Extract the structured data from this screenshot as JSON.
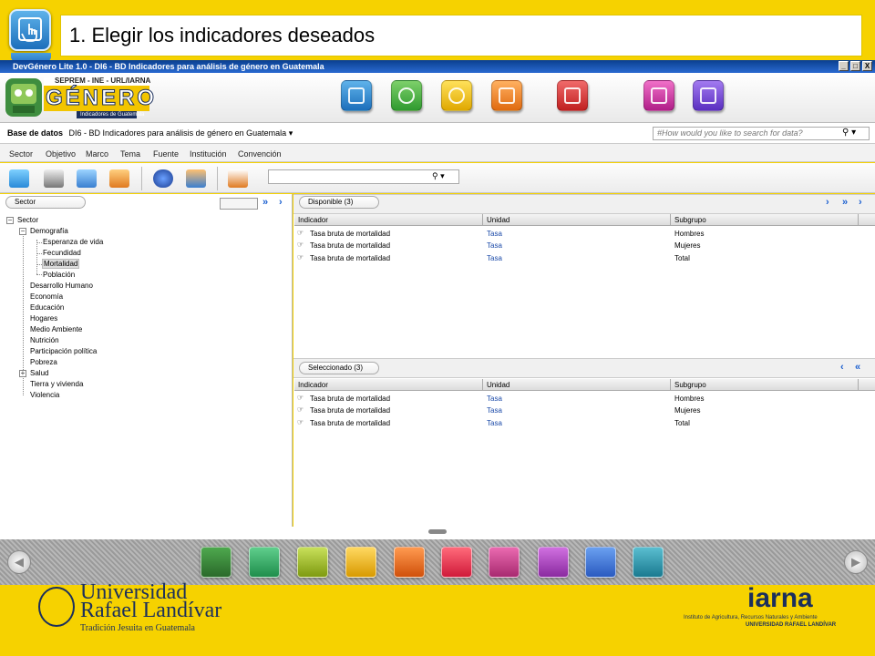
{
  "slide": {
    "title": "1. Elegir los indicadores deseados"
  },
  "window": {
    "title": "DevGénero Lite 1.0 - DI6 - BD Indicadores para análisis de género en Guatemala",
    "btn_min": "_",
    "btn_max": "□",
    "btn_close": "X"
  },
  "logo": {
    "org_line": "SEPREM - INE - URL/IARNA",
    "name": "GÉNERO",
    "tagline": "Indicadores de Guatemala"
  },
  "dbbar": {
    "label": "Base de datos",
    "value": "DI6 - BD Indicadores para análisis de género en Guatemala",
    "search_placeholder": "#How would you like to search for data?"
  },
  "menu": [
    "Sector",
    "Objetivo",
    "Marco",
    "Tema",
    "Fuente",
    "Institución",
    "Convención"
  ],
  "left": {
    "pill": "Sector",
    "tree": [
      {
        "label": "Sector",
        "level": 0,
        "expander": "−"
      },
      {
        "label": "Demografía",
        "level": 1,
        "expander": "−"
      },
      {
        "label": "Esperanza de vida",
        "level": 2
      },
      {
        "label": "Fecundidad",
        "level": 2
      },
      {
        "label": "Mortalidad",
        "level": 2,
        "selected": true
      },
      {
        "label": "Población",
        "level": 2
      },
      {
        "label": "Desarrollo Humano",
        "level": 1
      },
      {
        "label": "Economía",
        "level": 1
      },
      {
        "label": "Educación",
        "level": 1
      },
      {
        "label": "Hogares",
        "level": 1
      },
      {
        "label": "Medio Ambiente",
        "level": 1
      },
      {
        "label": "Nutrición",
        "level": 1
      },
      {
        "label": "Participación política",
        "level": 1
      },
      {
        "label": "Pobreza",
        "level": 1
      },
      {
        "label": "Salud",
        "level": 1,
        "expander": "+"
      },
      {
        "label": "Tierra y vivienda",
        "level": 1
      },
      {
        "label": "Violencia",
        "level": 1
      }
    ]
  },
  "available": {
    "pill": "Disponible (3)",
    "columns": [
      "Indicador",
      "Unidad",
      "Subgrupo"
    ],
    "rows": [
      {
        "indicador": "Tasa bruta de mortalidad",
        "unidad": "Tasa",
        "subgrupo": "Hombres"
      },
      {
        "indicador": "Tasa bruta de mortalidad",
        "unidad": "Tasa",
        "subgrupo": "Mujeres"
      },
      {
        "indicador": "Tasa bruta de mortalidad",
        "unidad": "Tasa",
        "subgrupo": "Total"
      }
    ]
  },
  "selected": {
    "pill": "Seleccionado (3)",
    "columns": [
      "Indicador",
      "Unidad",
      "Subgrupo"
    ],
    "rows": [
      {
        "indicador": "Tasa bruta de mortalidad",
        "unidad": "Tasa",
        "subgrupo": "Hombres"
      },
      {
        "indicador": "Tasa bruta de mortalidad",
        "unidad": "Tasa",
        "subgrupo": "Mujeres"
      },
      {
        "indicador": "Tasa bruta de mortalidad",
        "unidad": "Tasa",
        "subgrupo": "Total"
      }
    ]
  },
  "footer": {
    "url_line1": "Universidad",
    "url_line2": "Rafael Landívar",
    "url_line3": "Tradición Jesuita en Guatemala",
    "iarna": "iarna",
    "iarna_l1": "Instituto de Agricultura, Recursos Naturales y Ambiente",
    "iarna_l2": "UNIVERSIDAD RAFAEL LANDÍVAR"
  },
  "colors": {
    "accent_yellow": "#f6d200",
    "title_bar": "#0a3f8f",
    "link_blue": "#1a49a8"
  }
}
